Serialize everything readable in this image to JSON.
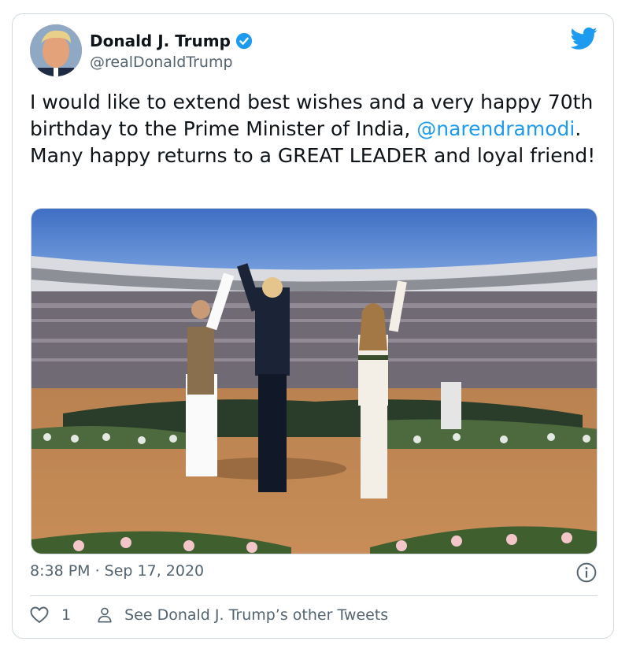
{
  "tweet": {
    "author_name": "Donald J. Trump",
    "handle": "@realDonaldTrump",
    "text_before": "I would like to extend best wishes and a very happy 70th birthday to the Prime Minister of India, ",
    "mention": "@narendramodi",
    "text_after": ". Many happy returns to a GREAT LEADER and loyal friend!",
    "timestamp": "8:38 PM · Sep 17, 2020",
    "like_count": "1",
    "see_other_label": "See Donald J. Trump’s other Tweets"
  },
  "icons": {
    "verified": "verified-badge-icon",
    "brand": "twitter-bird-icon",
    "info": "info-icon",
    "like": "heart-icon",
    "profile": "person-icon"
  },
  "colors": {
    "accent": "#1d9bf0",
    "secondary_text": "#536471",
    "border": "#cfd9de"
  }
}
